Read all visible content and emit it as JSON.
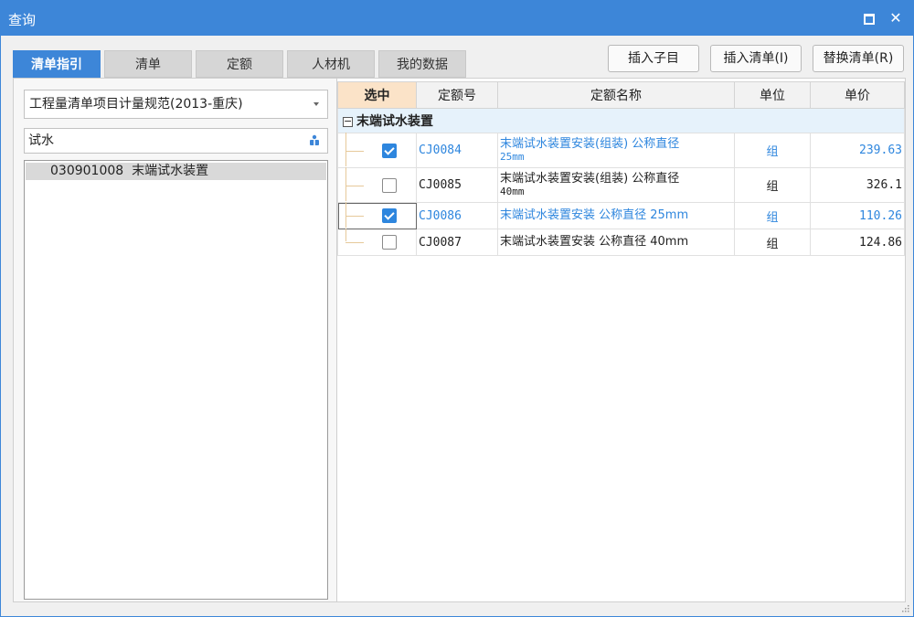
{
  "window": {
    "title": "查询"
  },
  "tabs": [
    {
      "label": "清单指引",
      "active": true
    },
    {
      "label": "清单",
      "active": false
    },
    {
      "label": "定额",
      "active": false
    },
    {
      "label": "人材机",
      "active": false
    },
    {
      "label": "我的数据",
      "active": false
    }
  ],
  "toolbar": {
    "insert_child": "插入子目",
    "insert_list": "插入清单(I)",
    "replace_list": "替换清单(R)"
  },
  "left_panel": {
    "spec_select": "工程量清单项目计量规范(2013-重庆)",
    "search_value": "试水",
    "tree_items": [
      {
        "code": "030901008",
        "name": "末端试水装置"
      }
    ]
  },
  "grid": {
    "columns": [
      "选中",
      "定额号",
      "定额名称",
      "单位",
      "单价"
    ],
    "group": {
      "title": "末端试水装置"
    },
    "rows": [
      {
        "checked": true,
        "code": "CJ0084",
        "name_line1": "末端试水装置安装(组装) 公称直径",
        "name_line2": "25mm",
        "unit": "组",
        "price": "239.63"
      },
      {
        "checked": false,
        "code": "CJ0085",
        "name_line1": "末端试水装置安装(组装) 公称直径",
        "name_line2": "40mm",
        "unit": "组",
        "price": "326.1"
      },
      {
        "checked": true,
        "code": "CJ0086",
        "name_line1": "末端试水装置安装 公称直径 25mm",
        "name_line2": "",
        "unit": "组",
        "price": "110.26"
      },
      {
        "checked": false,
        "code": "CJ0087",
        "name_line1": "末端试水装置安装 公称直径 40mm",
        "name_line2": "",
        "unit": "组",
        "price": "124.86"
      }
    ]
  },
  "colors": {
    "accent": "#3d86d8",
    "selected_text": "#2e86de",
    "header_highlight": "#fbe3c8",
    "group_row": "#e6f2fb"
  }
}
